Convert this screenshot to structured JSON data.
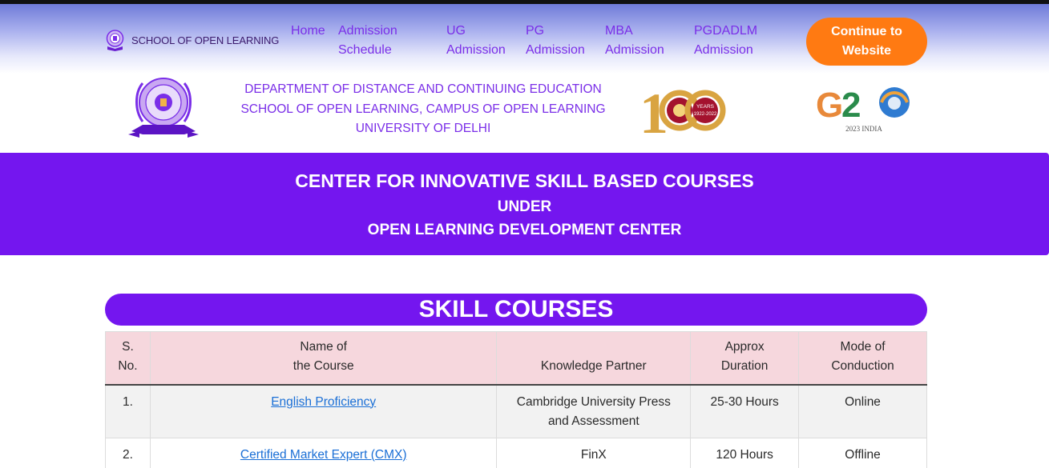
{
  "nav": {
    "brand_text": "SCHOOL OF OPEN LEARNING",
    "links": [
      {
        "line1": "Home",
        "line2": ""
      },
      {
        "line1": "Admission",
        "line2": "Schedule"
      },
      {
        "line1": "UG",
        "line2": "Admission"
      },
      {
        "line1": "PG",
        "line2": "Admission"
      },
      {
        "line1": "MBA",
        "line2": "Admission"
      },
      {
        "line1": "PGDADLM",
        "line2": "Admission"
      }
    ],
    "cta": {
      "line1": "Continue to",
      "line2": "Website"
    }
  },
  "header": {
    "lines": [
      "DEPARTMENT OF DISTANCE AND CONTINUING EDUCATION",
      "SCHOOL OF OPEN LEARNING, CAMPUS OF OPEN LEARNING",
      "UNIVERSITY OF DELHI"
    ],
    "centenary_logo": {
      "years_label": "YEARS",
      "range": "1922-2022"
    },
    "g20_logo": {
      "text": "G20",
      "sub": "2023 INDIA"
    }
  },
  "banner": {
    "line1": "CENTER FOR INNOVATIVE SKILL BASED COURSES",
    "line2": "UNDER",
    "line3": "OPEN LEARNING DEVELOPMENT CENTER"
  },
  "section": {
    "title": "SKILL COURSES"
  },
  "table": {
    "headers": {
      "sno": {
        "line1": "S.",
        "line2": "No."
      },
      "name": {
        "line1": "Name of",
        "line2": "the Course"
      },
      "partner": {
        "line1": "Knowledge Partner"
      },
      "duration": {
        "line1": "Approx",
        "line2": "Duration"
      },
      "mode": {
        "line1": "Mode of",
        "line2": "Conduction"
      }
    },
    "rows": [
      {
        "sno": "1.",
        "name": "English Proficiency",
        "partner_line1": "Cambridge University Press",
        "partner_line2": "and Assessment",
        "duration": "25-30 Hours",
        "mode": "Online"
      },
      {
        "sno": "2.",
        "name": "Certified Market Expert (CMX)",
        "partner_line1": "FinX",
        "partner_line2": "",
        "duration": "120 Hours",
        "mode": "Offline"
      }
    ]
  },
  "colors": {
    "accent_purple": "#7416ef",
    "link_purple": "#7a2ee8",
    "cta_orange": "#ff7a12",
    "table_header_pink": "#f6d7dd",
    "link_blue": "#1a6fd6"
  },
  "icons": {
    "brand": "sol-emblem-icon",
    "header_logo": "sol-diamond-jubilee-seal",
    "centenary": "du-centenary-100-logo",
    "g20": "g20-logo"
  }
}
